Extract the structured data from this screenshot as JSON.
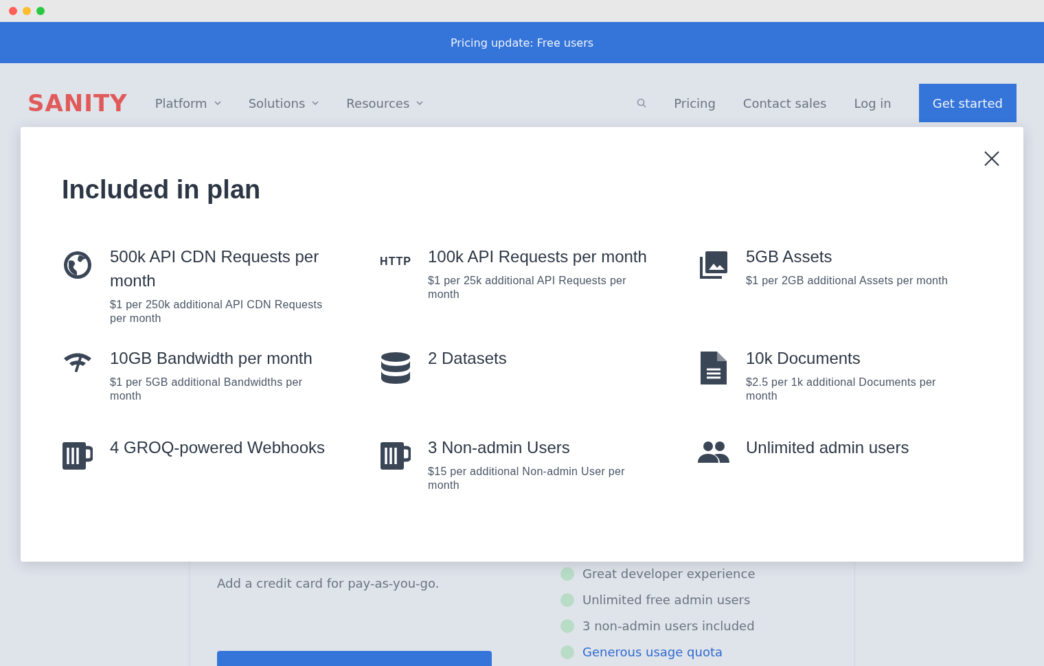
{
  "banner": {
    "text": "Pricing update: Free users"
  },
  "nav": {
    "logo": "SANITY",
    "menus": [
      "Platform",
      "Solutions",
      "Resources"
    ],
    "links": [
      "Pricing",
      "Contact sales",
      "Log in"
    ],
    "cta": "Get started"
  },
  "plan_card": {
    "note": "Add a credit card for pay-as-you-go.",
    "benefits": [
      {
        "text": "Great developer experience",
        "kind": "text"
      },
      {
        "text": "Unlimited free admin users",
        "kind": "text"
      },
      {
        "text": "3 non-admin users included",
        "kind": "text"
      },
      {
        "text": "Generous usage quota",
        "kind": "link"
      }
    ]
  },
  "modal": {
    "title": "Included in plan",
    "features": [
      {
        "kind": "globe",
        "title": "500k API CDN Requests per month",
        "detail": "$1 per 250k additional API CDN Requests per month"
      },
      {
        "kind": "badge",
        "badge": "HTTP",
        "title": "100k API Requests per month",
        "detail": "$1 per 25k additional API Requests per month"
      },
      {
        "kind": "images",
        "title": "5GB Assets",
        "detail": "$1 per 2GB additional Assets per month"
      },
      {
        "kind": "signal",
        "title": "10GB Bandwidth per month",
        "detail": "$1 per 5GB additional Bandwidths per month"
      },
      {
        "kind": "database",
        "title": "2 Datasets"
      },
      {
        "kind": "document",
        "title": "10k Documents",
        "detail": "$2.5 per 1k additional Documents per month"
      },
      {
        "kind": "mug",
        "title": "4 GROQ-powered Webhooks"
      },
      {
        "kind": "mug",
        "title": "3 Non-admin Users",
        "detail": "$15 per additional Non-admin User per month"
      },
      {
        "kind": "users",
        "title": "Unlimited admin users"
      }
    ]
  }
}
